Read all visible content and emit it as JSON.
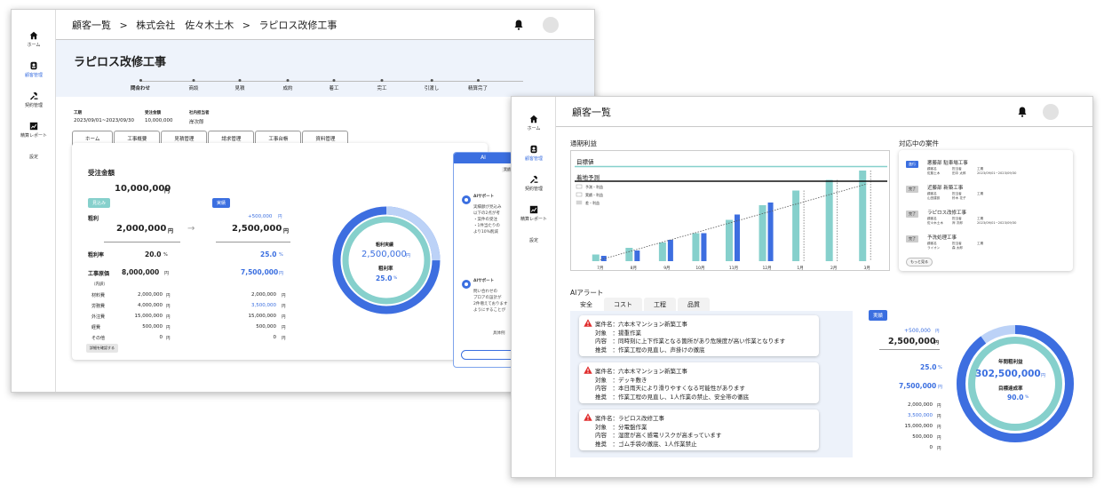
{
  "window_a": {
    "sidebar": [
      {
        "label": "ホーム",
        "icon": "home-icon"
      },
      {
        "label": "顧客管理",
        "icon": "customer-icon"
      },
      {
        "label": "契約管理",
        "icon": "contract-icon"
      },
      {
        "label": "精算レポート",
        "icon": "report-icon"
      },
      {
        "label": "設定",
        "icon": ""
      }
    ],
    "breadcrumb": [
      "顧客一覧",
      ">",
      "株式会社　佐々木土木",
      ">",
      "ラピロス改修工事"
    ],
    "page_title": "ラピロス改修工事",
    "steps": [
      "問合わせ",
      "商談",
      "見積",
      "成約",
      "着工",
      "完工",
      "引渡し",
      "精算完了"
    ],
    "meta": [
      {
        "key": "工期",
        "value": "2023/09/01~2023/09/30"
      },
      {
        "key": "受注金額",
        "value": "10,000,000"
      },
      {
        "key": "社内担当者",
        "value": "岸次郎"
      }
    ],
    "tabs": [
      "ホーム",
      "工事概要",
      "見積管理",
      "請求管理",
      "工事台帳",
      "資料管理"
    ],
    "summary": {
      "order_label": "受注金額",
      "order_value": "10,000,000",
      "order_unit": "円",
      "estimate_badge": "見込み",
      "actual_badge": "実績",
      "gross_label": "粗利",
      "gross_est": "2,000,000",
      "gross_est_unit": "円",
      "arrow": "→",
      "gross_delta": "+500,000",
      "gross_delta_unit": "円",
      "gross_act": "2,500,000",
      "gross_act_unit": "円",
      "rate_label": "粗利率",
      "rate_est": "20.0",
      "rate_act": "25.0",
      "pct": "%",
      "cost_label": "工事原価",
      "cost_est": "8,000,000",
      "cost_act": "7,500,000",
      "breakdown_label": "（内訳）",
      "rows": [
        {
          "label": "材料費",
          "est": "2,000,000",
          "act": "2,000,000",
          "hl": false
        },
        {
          "label": "労務費",
          "est": "4,000,000",
          "act": "3,500,000",
          "hl": true
        },
        {
          "label": "外注費",
          "est": "15,000,000",
          "act": "15,000,000",
          "hl": false
        },
        {
          "label": "経費",
          "est": "500,000",
          "act": "500,000",
          "hl": false
        },
        {
          "label": "その他",
          "est": "0",
          "act": "0",
          "hl": false
        }
      ],
      "yen": "円",
      "detail_button": "詳細を確認する",
      "donut_title": "粗利実績",
      "donut_value": "2,500,000",
      "donut_unit": "円",
      "donut_rate_label": "粗利率",
      "donut_rate": "25.0",
      "donut_rate_unit": "%",
      "donut_fraction": 0.25
    },
    "ai_panel": {
      "title": "AI",
      "tag": "実績",
      "support1": "AIサポート",
      "lines1": [
        "実績額が見込み",
        "以下の2点が考",
        "・案件の受注",
        "・1件当たりの",
        "より10%削減"
      ],
      "support2": "AIサポート",
      "lines2": [
        "問い合わせの",
        "プロアの設計が",
        "2件増えております",
        "ようにすることが"
      ],
      "more": "具体例"
    }
  },
  "window_b": {
    "sidebar": [
      {
        "label": "ホーム",
        "icon": "home-icon"
      },
      {
        "label": "顧客管理",
        "icon": "customer-icon"
      },
      {
        "label": "契約管理",
        "icon": "contract-icon"
      },
      {
        "label": "精算レポート",
        "icon": "report-icon"
      },
      {
        "label": "設定",
        "icon": ""
      }
    ],
    "breadcrumb": [
      "顧客一覧"
    ],
    "profit_title": "通期利益",
    "projects_title": "対応中の案件",
    "projects": [
      {
        "badge": "進行",
        "hot": true,
        "name": "悪藤部 駐車場工事",
        "k1": "顧客名",
        "v1": "佐藤土木",
        "k2": "担当者",
        "v2": "田中 太郎",
        "k3": "工期",
        "v3": "2023/09/01~2023/09/30"
      },
      {
        "badge": "完了",
        "hot": false,
        "name": "近藤部 新築工事",
        "k1": "顧客名",
        "v1": "山田建設",
        "k2": "担当者",
        "v2": "鈴木 花子",
        "k3": "工期",
        "v3": ""
      },
      {
        "badge": "完了",
        "hot": false,
        "name": "ラピロス改修工事",
        "k1": "顧客名",
        "v1": "佐々木土木",
        "k2": "担当者",
        "v2": "岸 次郎",
        "k3": "工期",
        "v3": "2023/09/01~2023/09/30"
      },
      {
        "badge": "完了",
        "hot": false,
        "name": "予洗処理工事",
        "k1": "顧客名",
        "v1": "ライオン",
        "k2": "担当者",
        "v2": "森 太郎",
        "k3": "工期",
        "v3": ""
      }
    ],
    "more_button": "もっと見る",
    "alerts_title": "AIアラート",
    "alert_tabs": [
      "安全",
      "コスト",
      "工程",
      "品質"
    ],
    "alerts": [
      {
        "l1": "案件名：六本木マンション新築工事",
        "l2": "対象　：揚重作業",
        "l3": "内容　：同時刻に上下作業となる箇所があり危険度が高い作業となります",
        "l4": "推奨　：作業工程の見直し、声掛けの徹底"
      },
      {
        "l1": "案件名：六本木マンション新築工事",
        "l2": "対象　：デッキ敷き",
        "l3": "内容　：本日雨天により滑りやすくなる可能性があります",
        "l4": "推奨　：作業工程の見直し、1人作業の禁止、安全帯の徹底"
      },
      {
        "l1": "案件名：ラピロス改修工事",
        "l2": "対象　：分電盤作業",
        "l3": "内容　：湿度が高く感電リスクが高まっています",
        "l4": "推奨　：ゴム手袋の徹底、1人作業禁止"
      }
    ],
    "yearly": {
      "badge": "実績",
      "delta": "+500,000",
      "value": "2,500,000",
      "rate": "25.0",
      "cost": "7,500,000",
      "rows": [
        "2,000,000",
        "3,500,000",
        "15,000,000",
        "500,000",
        "0"
      ],
      "yen": "円",
      "pct": "%",
      "donut_title": "年間粗利益",
      "donut_value": "302,500,000",
      "donut_unit": "円",
      "goal_label": "目標達成率",
      "goal_value": "90.0",
      "goal_unit": "%",
      "donut_fraction": 0.9
    },
    "chart_data": {
      "type": "bar",
      "categories": [
        "7月",
        "8月",
        "9月",
        "10月",
        "11月",
        "12月",
        "1月",
        "2月",
        "3月"
      ],
      "series": [
        {
          "name": "予測・利益",
          "values": [
            5,
            10,
            14,
            21,
            31,
            42,
            53,
            61,
            68
          ]
        },
        {
          "name": "実績・利益",
          "values": [
            4,
            8,
            16,
            21,
            35,
            44,
            0,
            0,
            0
          ]
        }
      ],
      "legend": [
        "予測・利益",
        "実績・利益",
        "差・利益"
      ],
      "annotations": [
        "目標値",
        "着地予測"
      ],
      "target": 71,
      "landing": 60,
      "ylim": [
        0,
        80
      ],
      "colors": {
        "forecast": "#86d0cc",
        "actual": "#3d6ee0"
      }
    }
  }
}
